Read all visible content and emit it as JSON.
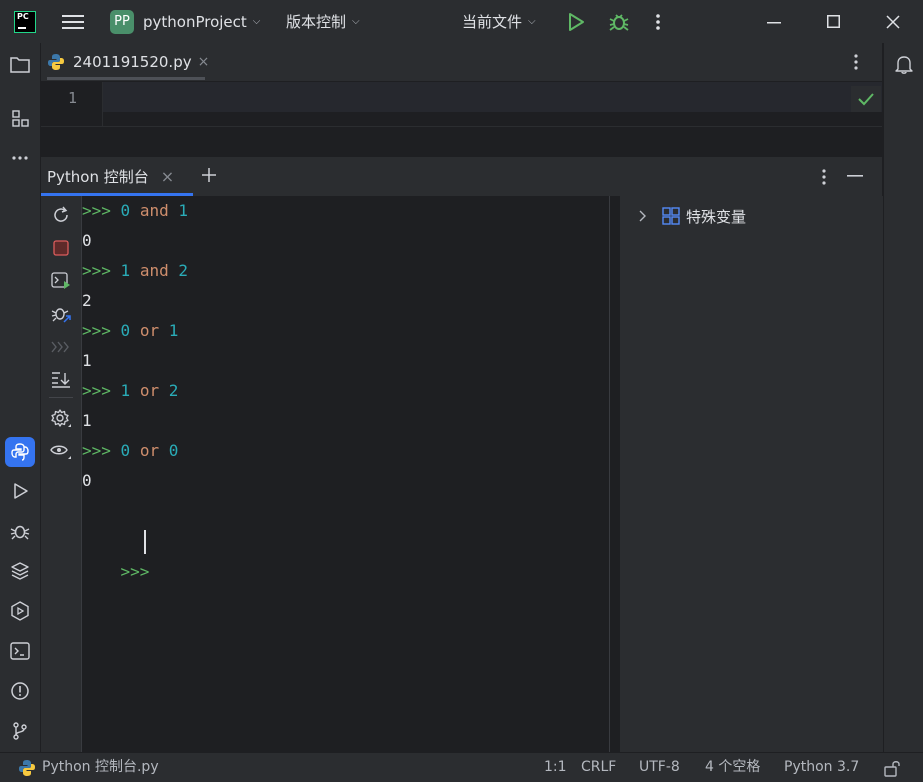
{
  "titlebar": {
    "app_logo_text": "PC",
    "project_badge": "PP",
    "project_name": "pythonProject",
    "vcs_label": "版本控制",
    "run_config": "当前文件"
  },
  "editor": {
    "tab_filename": "2401191520.py",
    "line_number": "1"
  },
  "console": {
    "tab_label": "Python 控制台",
    "lines": [
      {
        "type": "input",
        "prompt": ">>>",
        "a": "0",
        "op": "and",
        "b": "1"
      },
      {
        "type": "output",
        "text": "0"
      },
      {
        "type": "input",
        "prompt": ">>>",
        "a": "1",
        "op": "and",
        "b": "2"
      },
      {
        "type": "output",
        "text": "2"
      },
      {
        "type": "input",
        "prompt": ">>>",
        "a": "0",
        "op": "or",
        "b": "1"
      },
      {
        "type": "output",
        "text": "1"
      },
      {
        "type": "input",
        "prompt": ">>>",
        "a": "1",
        "op": "or",
        "b": "2"
      },
      {
        "type": "output",
        "text": "1"
      },
      {
        "type": "input",
        "prompt": ">>>",
        "a": "0",
        "op": "or",
        "b": "0"
      },
      {
        "type": "output",
        "text": "0"
      }
    ],
    "current_prompt": ">>>"
  },
  "variables": {
    "special_vars_label": "特殊变量"
  },
  "statusbar": {
    "console_name": "Python 控制台.py",
    "position": "1:1",
    "line_sep": "CRLF",
    "encoding": "UTF-8",
    "indent": "4 个空格",
    "interpreter": "Python 3.7"
  },
  "colors": {
    "prompt": "#5fb865",
    "number": "#2aacb8",
    "keyword": "#cf8e6d",
    "accent": "#3574f0"
  }
}
